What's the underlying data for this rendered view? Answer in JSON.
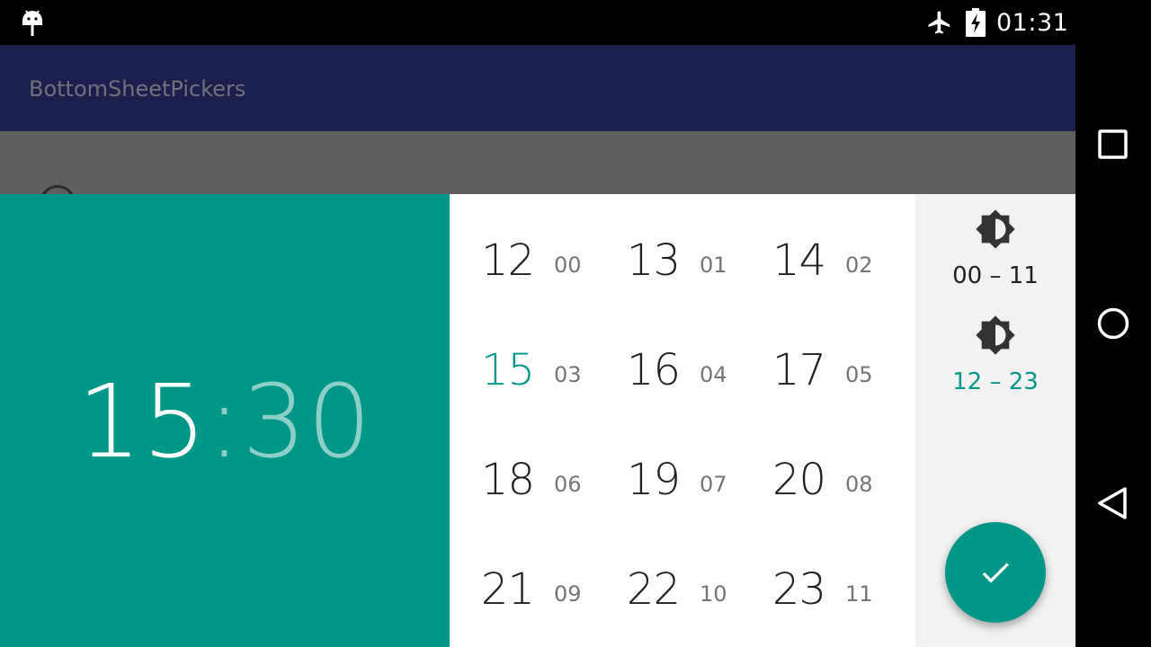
{
  "status_bar": {
    "time": "01:31",
    "icons": [
      "android-icon",
      "airplane-icon",
      "battery-charging-icon"
    ]
  },
  "app_bar": {
    "title": "BottomSheetPickers"
  },
  "time_display": {
    "hour": "15",
    "separator": ":",
    "minute": "30"
  },
  "hour_grid": [
    {
      "main": "12",
      "sub": "00"
    },
    {
      "main": "13",
      "sub": "01"
    },
    {
      "main": "14",
      "sub": "02"
    },
    {
      "main": "15",
      "sub": "03",
      "selected": true
    },
    {
      "main": "16",
      "sub": "04"
    },
    {
      "main": "17",
      "sub": "05"
    },
    {
      "main": "18",
      "sub": "06"
    },
    {
      "main": "19",
      "sub": "07"
    },
    {
      "main": "20",
      "sub": "08"
    },
    {
      "main": "21",
      "sub": "09"
    },
    {
      "main": "22",
      "sub": "10"
    },
    {
      "main": "23",
      "sub": "11"
    }
  ],
  "half_day": {
    "am_label": "00 – 11",
    "pm_label": "12 – 23",
    "selected": "pm"
  },
  "fab": {
    "icon": "check-icon"
  },
  "colors": {
    "accent": "#009688",
    "app_bar": "#1a1f4b",
    "text_primary": "#212121",
    "text_secondary": "#757575",
    "side_panel": "#f2f2f2"
  },
  "nav_bar": {
    "icons": [
      "recents-icon",
      "home-icon",
      "back-icon"
    ]
  }
}
